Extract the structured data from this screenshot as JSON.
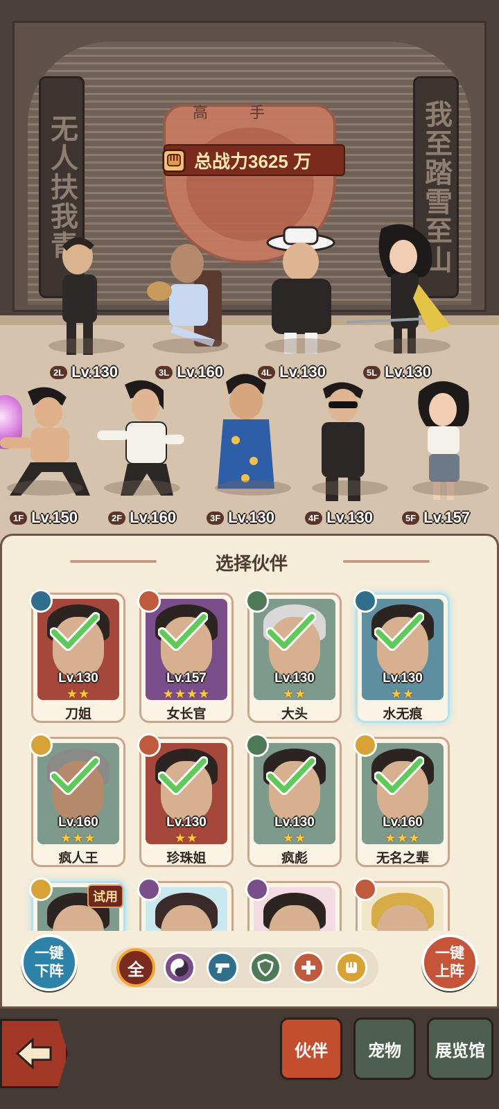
{
  "stage": {
    "scroll_left": "无人扶我青",
    "scroll_right": "我至踏雪至山",
    "emblem_title": "高手",
    "power_label": "总战力3625 万"
  },
  "lineup": [
    {
      "pos": "2L",
      "level": "Lv.130"
    },
    {
      "pos": "3L",
      "level": "Lv.160"
    },
    {
      "pos": "4L",
      "level": "Lv.130"
    },
    {
      "pos": "5L",
      "level": "Lv.130"
    },
    {
      "pos": "1F",
      "level": "Lv.150"
    },
    {
      "pos": "2F",
      "level": "Lv.160"
    },
    {
      "pos": "3F",
      "level": "Lv.130"
    },
    {
      "pos": "4F",
      "level": "Lv.130"
    },
    {
      "pos": "5F",
      "level": "Lv.157"
    }
  ],
  "panel": {
    "title": "选择伙伴",
    "cards": [
      {
        "name": "刀姐",
        "level": "Lv.130",
        "stars": "★★",
        "class_icon": "gun-icon"
      },
      {
        "name": "女长官",
        "level": "Lv.157",
        "stars": "★★★★",
        "class_icon": "medic-icon"
      },
      {
        "name": "大头",
        "level": "Lv.130",
        "stars": "★★",
        "class_icon": "shield-icon"
      },
      {
        "name": "水无痕",
        "level": "Lv.130",
        "stars": "★★",
        "class_icon": "gun-icon"
      },
      {
        "name": "疯人王",
        "level": "Lv.160",
        "stars": "★★★",
        "class_icon": "fist-icon"
      },
      {
        "name": "珍珠姐",
        "level": "Lv.130",
        "stars": "★★",
        "class_icon": "medic-icon"
      },
      {
        "name": "疯彪",
        "level": "Lv.130",
        "stars": "★★",
        "class_icon": "shield-icon"
      },
      {
        "name": "无名之辈",
        "level": "Lv.160",
        "stars": "★★★",
        "class_icon": "fist-icon"
      }
    ],
    "trial_label": "试用"
  },
  "controls": {
    "one_key_down": "一键\n下阵",
    "one_key_up": "一键\n上阵",
    "filter_all": "全"
  },
  "footer": {
    "tab_partner": "伙伴",
    "tab_pet": "宠物",
    "tab_gallery": "展览馆"
  },
  "colors": {
    "gun": "#2f6f8c",
    "medic": "#c05a3c",
    "shield": "#4f7a55",
    "fist": "#d9a235",
    "yinyang": "#7a4e8a",
    "check": "#5fc95a"
  }
}
